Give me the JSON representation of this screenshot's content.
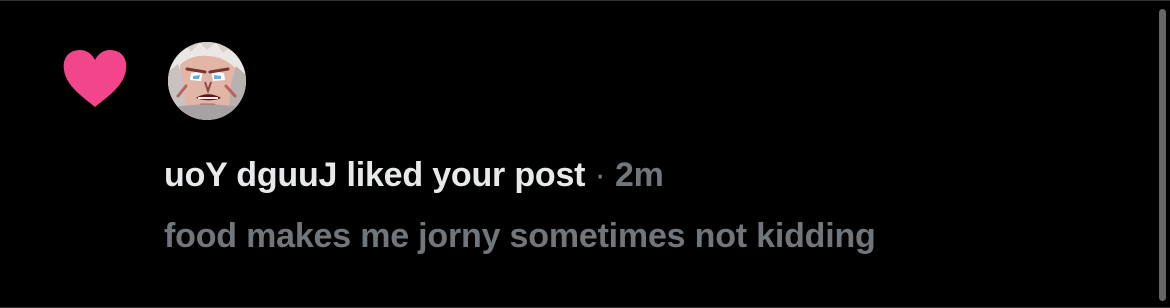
{
  "notification": {
    "type": "like",
    "actor_name": "uoY dguuJ",
    "action_text": " liked your post",
    "separator": " · ",
    "time": "2m",
    "post_snippet": "food makes me jorny sometimes not kidding",
    "icon": "heart-icon",
    "avatar": "anime-character-avatar"
  },
  "colors": {
    "background": "#000000",
    "heart": "#f2458c",
    "primary_text": "#e7e9ea",
    "secondary_text": "#71767b",
    "scrollbar": "#666666"
  }
}
